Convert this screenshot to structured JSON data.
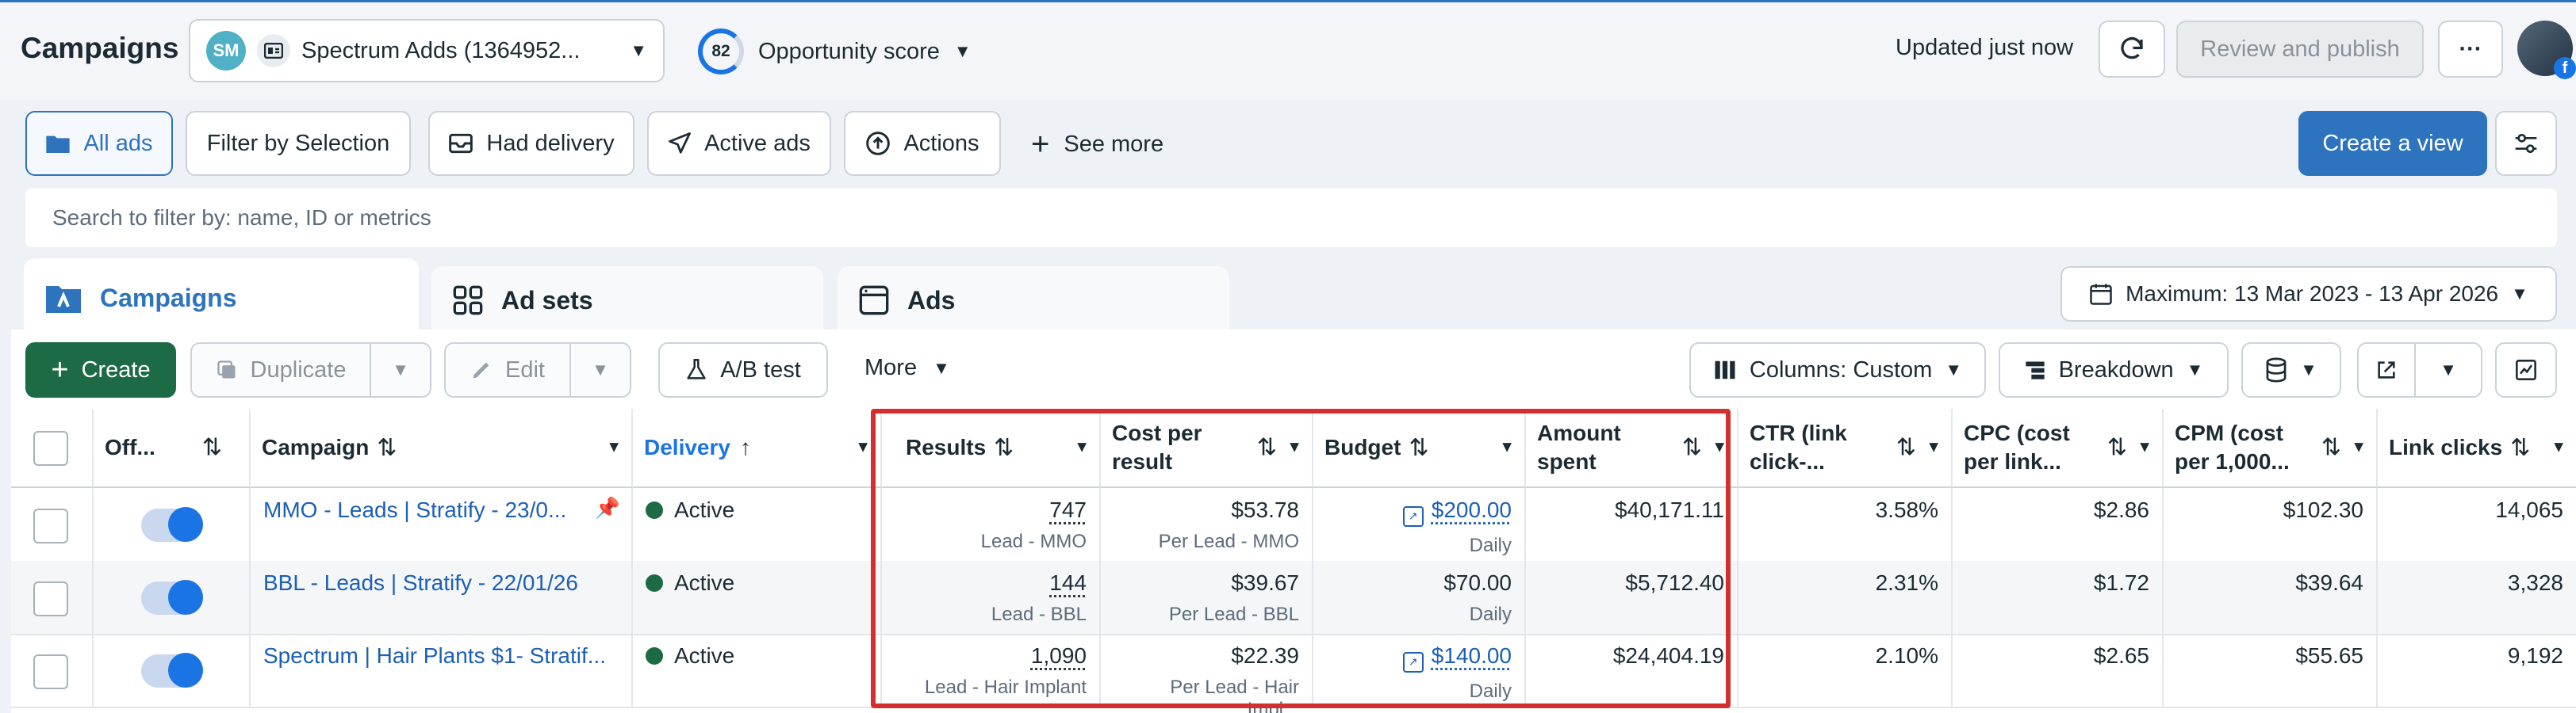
{
  "header": {
    "title": "Campaigns",
    "account_name": "Spectrum Adds (1364952...",
    "opportunity_score": "82",
    "opportunity_label": "Opportunity score",
    "updated": "Updated just now",
    "review_publish": "Review and publish",
    "more": "···"
  },
  "filters": {
    "all_ads": "All ads",
    "filter_by_selection": "Filter by Selection",
    "had_delivery": "Had delivery",
    "active_ads": "Active ads",
    "actions": "Actions",
    "see_more": "See more",
    "create_view": "Create a view",
    "search_placeholder": "Search to filter by: name, ID or metrics"
  },
  "tabs": [
    {
      "label": "Campaigns",
      "active": true
    },
    {
      "label": "Ad sets"
    },
    {
      "label": "Ads"
    }
  ],
  "date_range": "Maximum: 13 Mar 2023 - 13 Apr 2026",
  "toolbar": {
    "create": "Create",
    "duplicate": "Duplicate",
    "edit": "Edit",
    "ab_test": "A/B test",
    "more": "More",
    "columns": "Columns: Custom",
    "breakdown": "Breakdown"
  },
  "columns": {
    "off": "Off...",
    "campaign": "Campaign",
    "delivery": "Delivery",
    "results": "Results",
    "cpr_1": "Cost per",
    "cpr_2": "result",
    "budget": "Budget",
    "spent_1": "Amount",
    "spent_2": "spent",
    "ctr_1": "CTR (link",
    "ctr_2": "click-...",
    "cpc_1": "CPC (cost",
    "cpc_2": "per link...",
    "cpm_1": "CPM (cost",
    "cpm_2": "per 1,000...",
    "clicks": "Link clicks"
  },
  "rows": [
    {
      "campaign": "MMO - Leads | Stratify - 23/0...",
      "delivery": "Active",
      "results": "747",
      "results_sub": "Lead - MMO",
      "cpr": "$53.78",
      "cpr_sub": "Per Lead - MMO",
      "budget": "$200.00",
      "budget_sub": "Daily",
      "spent": "$40,171.11",
      "ctr": "3.58%",
      "cpc": "$2.86",
      "cpm": "$102.30",
      "clicks": "14,065"
    },
    {
      "campaign": "BBL - Leads | Stratify - 22/01/26",
      "delivery": "Active",
      "results": "144",
      "results_sub": "Lead - BBL",
      "cpr": "$39.67",
      "cpr_sub": "Per Lead - BBL",
      "budget": "$70.00",
      "budget_sub": "Daily",
      "spent": "$5,712.40",
      "ctr": "2.31%",
      "cpc": "$1.72",
      "cpm": "$39.64",
      "clicks": "3,328"
    },
    {
      "campaign": "Spectrum | Hair Plants $1- Stratif...",
      "delivery": "Active",
      "results": "1,090",
      "results_sub": "Lead - Hair Implant",
      "cpr": "$22.39",
      "cpr_sub": "Per Lead - Hair Impl...",
      "budget": "$140.00",
      "budget_sub": "Daily",
      "spent": "$24,404.19",
      "ctr": "2.10%",
      "cpc": "$2.65",
      "cpm": "$55.65",
      "clicks": "9,192"
    }
  ],
  "colors": {
    "accent": "#1b74e4",
    "active_dot": "#1d6b45",
    "highlight": "#d32f2f"
  }
}
